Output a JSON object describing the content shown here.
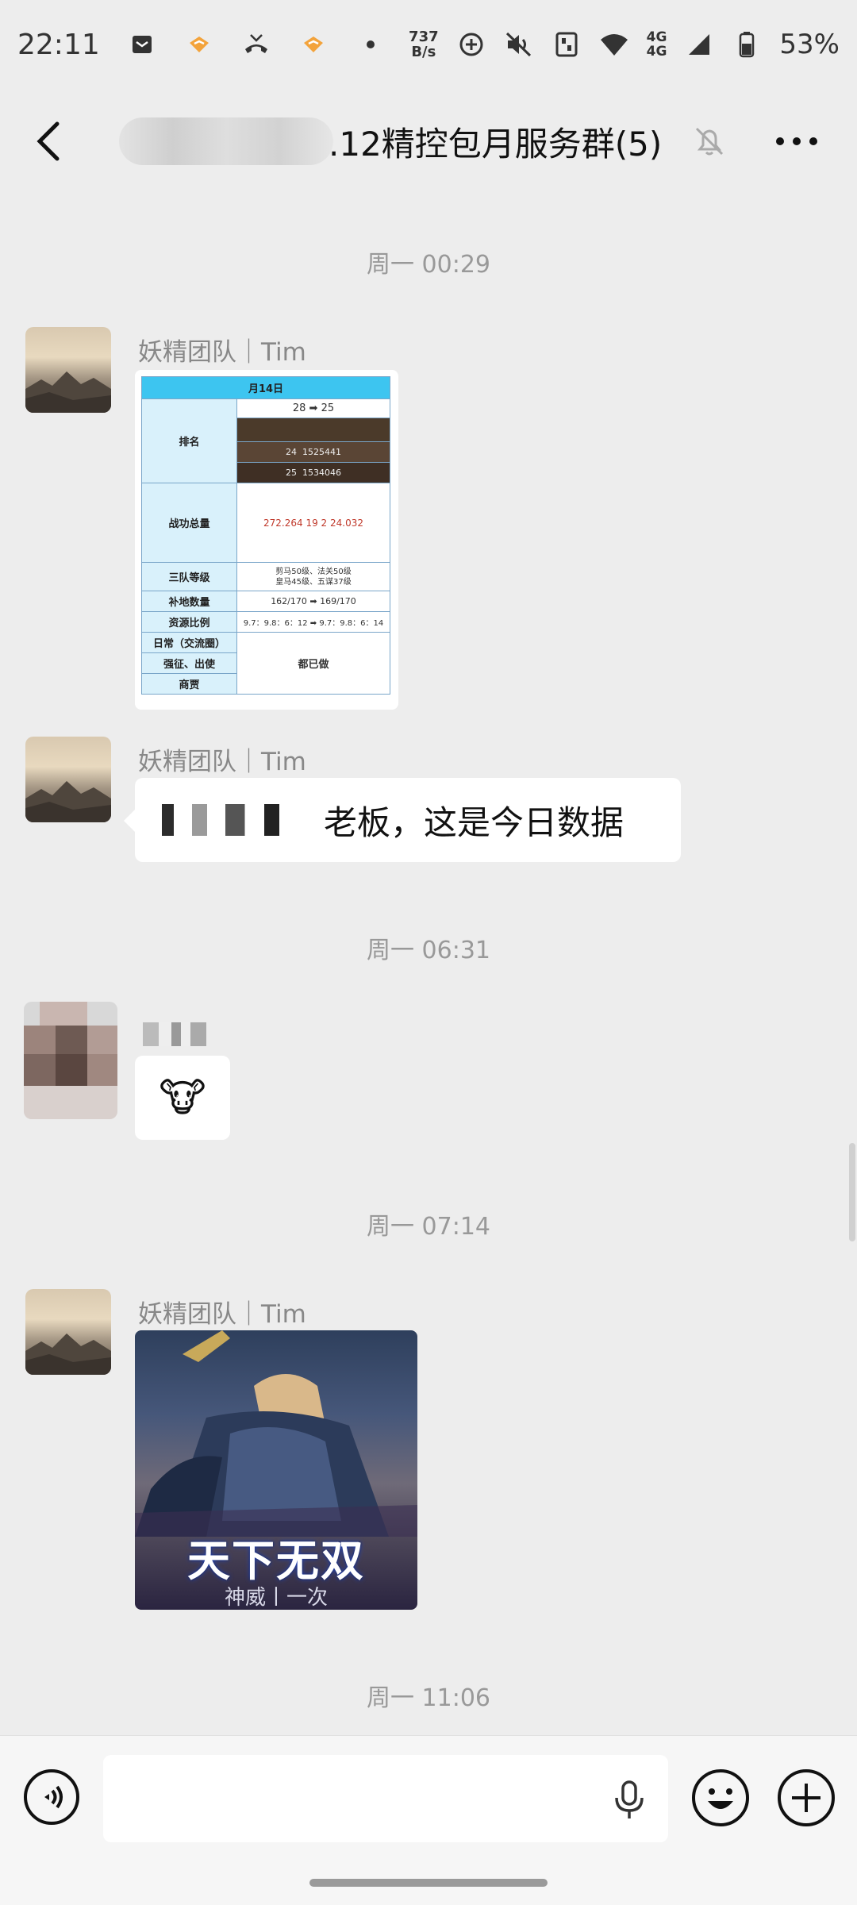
{
  "status_bar": {
    "time": "22:11",
    "net_speed_value": "737",
    "net_speed_unit": "B/s",
    "network_line1": "4G",
    "network_line2": "4G",
    "battery": "53%"
  },
  "header": {
    "title": ".12精控包月服务群(5)"
  },
  "messages": {
    "ts1": "周一 00:29",
    "msg1_sender": "妖精团队｜Tim",
    "sheet": {
      "date": "月14日",
      "rank_label": "排名",
      "rank_from": "28",
      "rank_to": "25",
      "rank_cell_1": "24",
      "rank_cell_1b": "1525441",
      "rank_cell_2": "25",
      "rank_cell_2b": "1534046",
      "power_label": "战功总量",
      "power_values": [
        "272.264",
        "19",
        "2",
        "24.032"
      ],
      "team_level_label": "三队等级",
      "team_level_line1": "剪马50级、法关50级",
      "team_level_line2": "皇马45级、五谋37级",
      "land_label": "补地数量",
      "land_value": "162/170 ➡ 169/170",
      "ratio_label": "资源比例",
      "ratio_value": "9.7：9.8：6：12 ➡ 9.7：9.8：6：14",
      "daily_label": "日常（交流圈）",
      "levy_label": "强征、出使",
      "tribute_label": "商贾",
      "done_value": "都已做"
    },
    "msg2_sender": "妖精团队｜Tim",
    "msg2_text": "老板，这是今日数据",
    "ts2": "周一 06:31",
    "msg3_emoji": "🐮",
    "ts3": "周一 07:14",
    "msg4_sender": "妖精团队｜Tim",
    "game_title": "天下无双",
    "game_sub": "神威丨一次",
    "ts4": "周一 11:06"
  },
  "colors": {
    "background": "#ededed",
    "bubble": "#ffffff",
    "timestamp": "#999999",
    "sheet_header": "#3dc5f0"
  }
}
